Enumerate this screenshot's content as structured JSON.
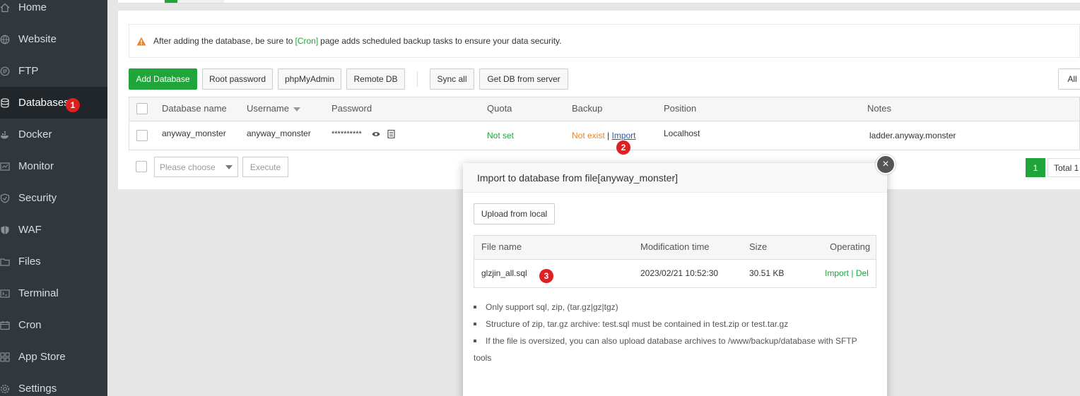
{
  "sidebar": {
    "items": [
      {
        "label": "Home",
        "icon": "home-icon"
      },
      {
        "label": "Website",
        "icon": "globe-icon"
      },
      {
        "label": "FTP",
        "icon": "ftp-icon"
      },
      {
        "label": "Databases",
        "icon": "database-icon",
        "active": true
      },
      {
        "label": "Docker",
        "icon": "docker-icon"
      },
      {
        "label": "Monitor",
        "icon": "monitor-icon"
      },
      {
        "label": "Security",
        "icon": "shield-icon"
      },
      {
        "label": "WAF",
        "icon": "waf-shield-icon"
      },
      {
        "label": "Files",
        "icon": "folder-icon"
      },
      {
        "label": "Terminal",
        "icon": "terminal-icon"
      },
      {
        "label": "Cron",
        "icon": "calendar-icon"
      },
      {
        "label": "App Store",
        "icon": "grid-icon"
      },
      {
        "label": "Settings",
        "icon": "gear-icon"
      }
    ]
  },
  "badges": {
    "one": "1",
    "two": "2",
    "three": "3"
  },
  "alert": {
    "prefix": "After adding the database, be sure to",
    "cron_link": "[Cron]",
    "suffix": "page adds scheduled backup tasks to ensure your data security."
  },
  "toolbar": {
    "add_database": "Add Database",
    "root_password": "Root password",
    "phpmyadmin": "phpMyAdmin",
    "remote_db": "Remote DB",
    "sync_all": "Sync all",
    "get_db": "Get DB from server",
    "filter_all": "All"
  },
  "table": {
    "headers": {
      "name": "Database name",
      "username": "Username",
      "password": "Password",
      "quota": "Quota",
      "backup": "Backup",
      "position": "Position",
      "notes": "Notes"
    },
    "row": {
      "name": "anyway_monster",
      "username": "anyway_monster",
      "password": "**********",
      "quota": "Not set",
      "backup_status": "Not exist",
      "backup_sep": "|",
      "backup_import": "Import",
      "position": "Localhost",
      "notes": "ladder.anyway.monster"
    }
  },
  "batch": {
    "select_placeholder": "Please choose",
    "execute": "Execute"
  },
  "pagination": {
    "current": "1",
    "total": "Total 1"
  },
  "modal": {
    "title": "Import to database from file[anyway_monster]",
    "upload_button": "Upload from local",
    "close": "×",
    "file_table": {
      "headers": {
        "name": "File name",
        "mtime": "Modification time",
        "size": "Size",
        "ops": "Operating"
      },
      "rows": [
        {
          "name": "glzjin_all.sql",
          "mtime": "2023/02/21 10:52:30",
          "size": "30.51 KB",
          "import": "Import",
          "sep": "|",
          "del": "Del"
        }
      ]
    },
    "notes": [
      "Only support sql, zip, (tar.gz|gz|tgz)",
      "Structure of zip, tar.gz archive: test.sql must be contained in test.zip or test.tar.gz",
      "If the file is oversized, you can also upload database archives to /www/backup/database with SFTP",
      "tools"
    ]
  },
  "colors": {
    "accent": "#20a53a",
    "sidebar": "#31383d",
    "badge": "#e02020",
    "warning": "#e6852b"
  }
}
